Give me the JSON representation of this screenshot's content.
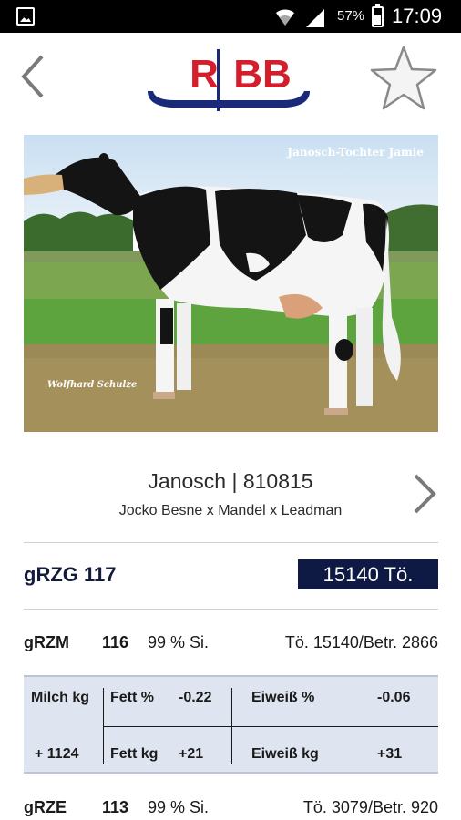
{
  "status_bar": {
    "battery_percent": "57%",
    "time": "17:09"
  },
  "header": {
    "logo_text": "RBB",
    "back_icon": "chevron-left-icon",
    "favorite_icon": "star-icon"
  },
  "photo": {
    "caption_top_right": "Janosch-Tochter Jamie",
    "caption_bottom_left": "Wolfhard Schulze"
  },
  "bull": {
    "title": "Janosch | 810815",
    "pedigree": "Jocko Besne x Mandel x Leadman"
  },
  "grzg": {
    "label": "gRZG 117",
    "badge": "15140 Tö."
  },
  "grzm": {
    "label": "gRZM",
    "value": "116",
    "si": "99 % Si.",
    "info": "Tö. 15140/Betr. 2866"
  },
  "milk": {
    "milch_label": "Milch kg",
    "milch_value": "+ 1124",
    "fett_pct_label": "Fett %",
    "fett_pct_value": "-0.22",
    "fett_kg_label": "Fett kg",
    "fett_kg_value": "+21",
    "eiweiss_pct_label": "Eiweiß %",
    "eiweiss_pct_value": "-0.06",
    "eiweiss_kg_label": "Eiweiß kg",
    "eiweiss_kg_value": "+31"
  },
  "grze": {
    "label": "gRZE",
    "value": "113",
    "si": "99 % Si.",
    "info": "Tö. 3079/Betr. 920"
  },
  "colors": {
    "brand_red": "#d21f2b",
    "brand_blue": "#1a2a78",
    "badge_bg": "#0f1a44",
    "table_bg": "#dfe5f0"
  }
}
